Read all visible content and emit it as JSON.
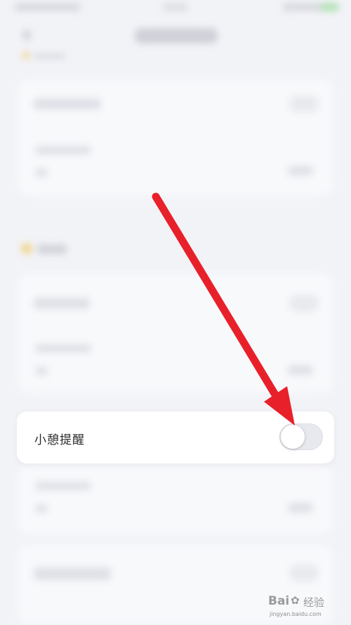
{
  "focus_row": {
    "label": "小憩提醒",
    "toggle_state": "off"
  },
  "annotation": {
    "arrow_color": "#e8202a"
  },
  "watermark": {
    "brand": "Bai",
    "brand_tail": "经验",
    "site": "jingyan.baidu.com"
  }
}
